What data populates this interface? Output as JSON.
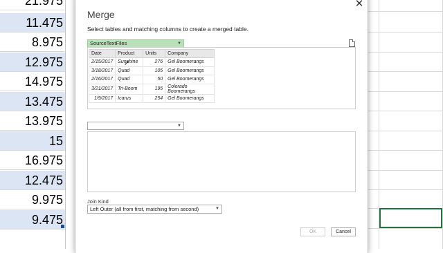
{
  "sheet": {
    "values": [
      "21.975",
      "11.475",
      "8.975",
      "12.975",
      "14.975",
      "13.475",
      "13.975",
      "15",
      "16.975",
      "12.475",
      "9.975",
      "9.475"
    ]
  },
  "dialog": {
    "title": "Merge",
    "subtitle": "Select tables and matching columns to create a merged table.",
    "close_glyph": "✕",
    "first_table_select": "SourceTextFiles",
    "second_table_select": "",
    "preview": {
      "headers": [
        "Date",
        "Product",
        "Units",
        "Company"
      ],
      "rows": [
        [
          "2/15/2017",
          "Sunshine",
          "276",
          "Gel Boomerangs"
        ],
        [
          "3/18/2017",
          "Quad",
          "105",
          "Gel Boomerangs"
        ],
        [
          "2/16/2017",
          "Quad",
          "50",
          "Gel Boomerangs"
        ],
        [
          "3/21/2017",
          "Tri-Boom",
          "195",
          "Colorado Boomerangs"
        ],
        [
          "1/9/2017",
          "Icarus",
          "254",
          "Gel Boomerangs"
        ]
      ]
    },
    "join_kind_label": "Join Kind",
    "join_kind_value": "Left Outer (all from first, matching from second)",
    "ok_label": "OK",
    "cancel_label": "Cancel"
  },
  "colors": {
    "accent_green": "#b9e1b9",
    "selected_cell": "#217346",
    "cell_blue": "#dbe5f4"
  }
}
